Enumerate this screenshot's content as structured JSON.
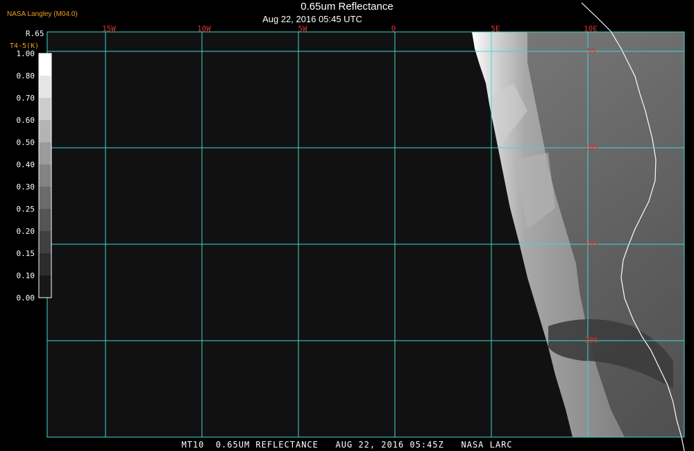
{
  "header": {
    "agency": "NASA Langley (M04.0)",
    "title": "0.65um Reflectance",
    "subtitle": "Aug 22, 2016 05:45 UTC"
  },
  "legend": {
    "label": "R.65",
    "sublabel": "T4-5(K)",
    "ticks": [
      "1.00",
      "0.80",
      "0.70",
      "0.60",
      "0.50",
      "0.40",
      "0.30",
      "0.25",
      "0.20",
      "0.15",
      "0.10",
      "0.00"
    ]
  },
  "map": {
    "longitude_labels": [
      "15W",
      "10W",
      "5W",
      "0",
      "5E",
      "10E"
    ],
    "latitude_labels": [
      "5S",
      "10S",
      "15S",
      "20S"
    ],
    "grid_color": "#40d8d8",
    "label_color": "#e03030",
    "coast_color": "#ffffff"
  },
  "footer": {
    "text": "MT10  0.65UM REFLECTANCE   AUG 22, 2016 05:45Z   NASA LARC"
  }
}
